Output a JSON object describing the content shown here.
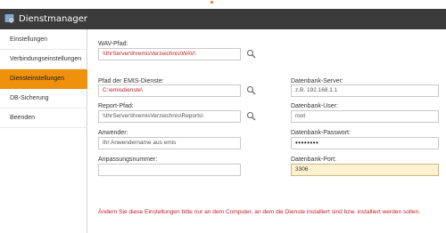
{
  "window": {
    "title": "Dienstmanager",
    "accent_color": "#f0910e",
    "titlebar_color": "#3b3b3b"
  },
  "sidebar": {
    "items": [
      {
        "label": "Einstellungen",
        "active": false
      },
      {
        "label": "Verbindungseinstellungen",
        "active": false
      },
      {
        "label": "Diensteinstellungen",
        "active": true
      },
      {
        "label": "DB-Sicherung",
        "active": false
      },
      {
        "label": "Beenden",
        "active": false
      }
    ]
  },
  "form": {
    "wav_path": {
      "label": "WAV-Pfad:",
      "value": "\\\\IhrServer\\IhremisVerzeichnis\\WAV\\"
    },
    "emis_path": {
      "label": "Pfad der EMIS-Dienste:",
      "value": "C:\\emisdienste\\"
    },
    "report_path": {
      "label": "Report-Pfad:",
      "value": "\\\\IhrServer\\IhremisVerzeichnis\\Reports\\"
    },
    "user": {
      "label": "Anwender:",
      "value": "Ihr Anwendername aus emis"
    },
    "adjust_no": {
      "label": "Anpassungsnummer:",
      "value": ""
    },
    "db_server": {
      "label": "Datenbank-Server:",
      "value": "z.B. 192.168.1.1"
    },
    "db_user": {
      "label": "Datenbank-User:",
      "value": "root"
    },
    "db_password": {
      "label": "Datenbank-Passwort:",
      "value": "••••••••"
    },
    "db_port": {
      "label": "Datenbank-Port:",
      "value": "3306"
    }
  },
  "note": "Ändern Sie diese Einstellungen bitte nur an dem Computer, an dem die Dienste installiert sind bzw. installiert werden sollen.",
  "icons": {
    "app": "gear-icon",
    "browse": "search-icon"
  }
}
